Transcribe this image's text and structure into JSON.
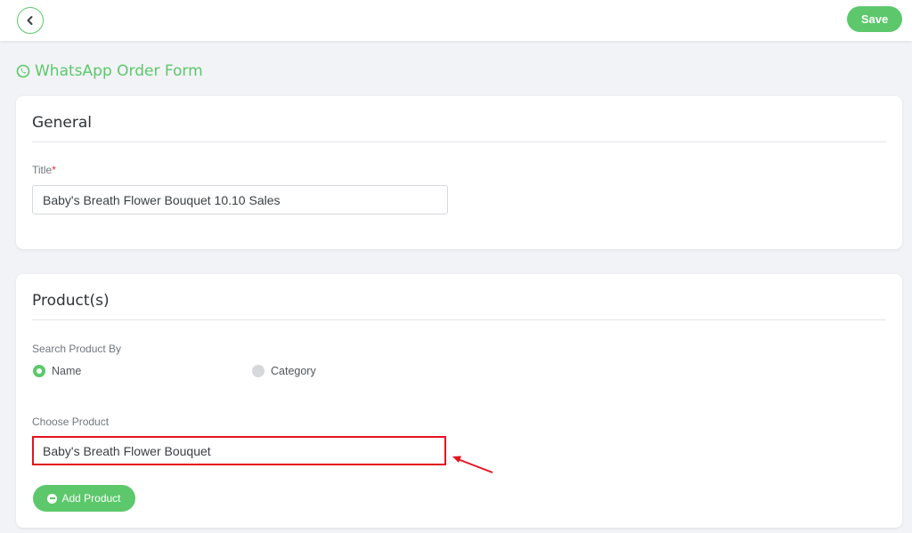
{
  "header": {
    "back_icon": "chevron-left-icon",
    "save_label": "Save"
  },
  "page": {
    "title": "WhatsApp Order Form",
    "title_icon": "whatsapp-icon"
  },
  "general": {
    "heading": "General",
    "title_label": "Title",
    "required_mark": "*",
    "title_value": "Baby's Breath Flower Bouquet 10.10 Sales"
  },
  "products": {
    "heading": "Product(s)",
    "search_by_label": "Search Product By",
    "options": [
      {
        "label": "Name",
        "selected": true
      },
      {
        "label": "Category",
        "selected": false
      }
    ],
    "choose_label": "Choose Product",
    "choose_value": "Baby's Breath Flower Bouquet",
    "add_label": "Add Product"
  },
  "colors": {
    "accent": "#5cc86b",
    "highlight": "#e3131f",
    "background": "#f1f3f6"
  }
}
